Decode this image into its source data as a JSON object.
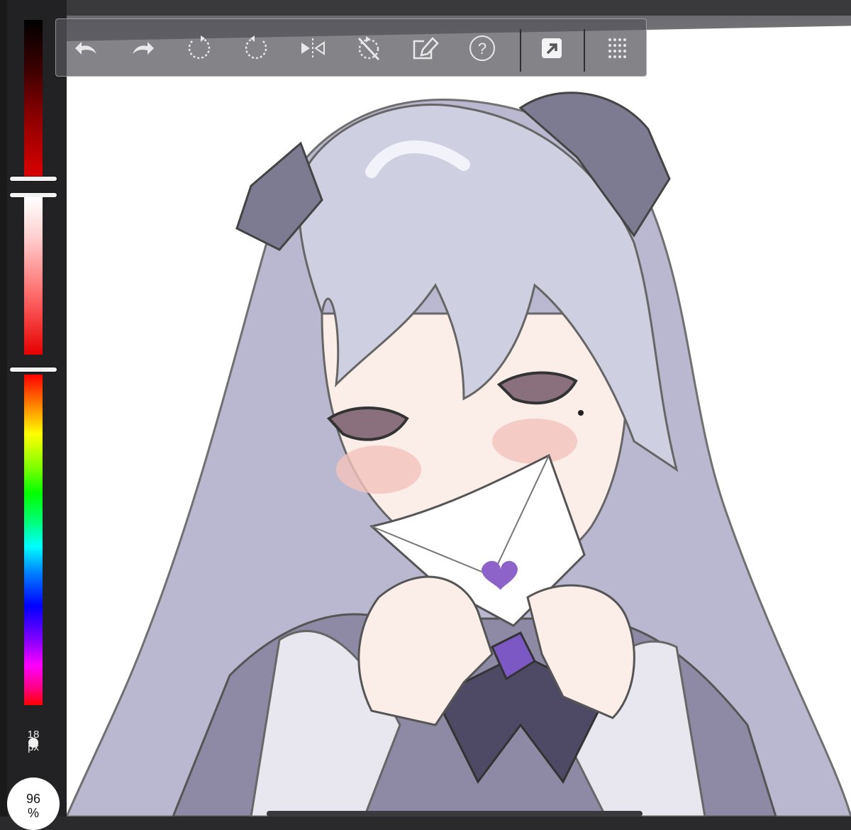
{
  "toolbar": {
    "tools": [
      {
        "icon": "undo-icon"
      },
      {
        "icon": "redo-icon"
      },
      {
        "icon": "rotate-left-icon"
      },
      {
        "icon": "rotate-right-icon"
      },
      {
        "icon": "flip-horizontal-icon"
      },
      {
        "icon": "reset-rotation-icon"
      },
      {
        "icon": "transform-icon"
      },
      {
        "icon": "help-icon"
      },
      {
        "icon": "export-icon"
      },
      {
        "icon": "grid-menu-icon"
      }
    ]
  },
  "sidebar": {
    "brush_size_value": "18",
    "brush_size_unit": "px",
    "opacity_value": "96",
    "opacity_unit": "%",
    "slider_colors": {
      "dark": [
        "#000000",
        "#e00000"
      ],
      "light": [
        "#ffffff",
        "#e60000"
      ],
      "hue": [
        "#ff0000",
        "#ffff00",
        "#00ff00",
        "#00ffff",
        "#0000ff",
        "#ff00ff",
        "#ff0000"
      ]
    }
  },
  "colors": {
    "hair": "#c9c9dc",
    "hair_shadow": "#a9a8c4",
    "ribbon": "#7c7b92",
    "skin": "#fbeee9",
    "blush": "#f4c3bb",
    "eye": "#8a6f7c",
    "dress": "#8e8aa6",
    "heart": "#8e63c9"
  }
}
